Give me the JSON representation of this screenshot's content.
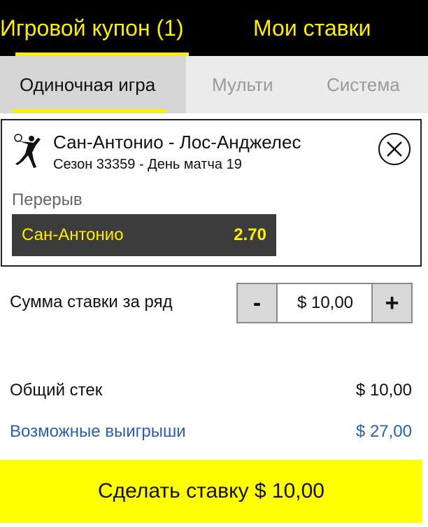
{
  "header": {
    "tabs": [
      {
        "label": "Игровой купон (1)"
      },
      {
        "label": "Мои ставки"
      }
    ]
  },
  "bet_type_tabs": [
    {
      "label": "Одиночная игра"
    },
    {
      "label": "Мульти"
    },
    {
      "label": "Система"
    }
  ],
  "bet_card": {
    "sport_icon": "basketball-player-icon",
    "match": "Сан-Антонио - Лос-Анджелес",
    "details": "Сезон 33359 - День матча 19",
    "market": "Перерыв",
    "selection": "Сан-Антонио",
    "odds": "2.70",
    "close_icon": "close-icon"
  },
  "stake": {
    "label": "Сумма ставки за ряд",
    "minus": "-",
    "value": "$ 10,00",
    "plus": "+"
  },
  "summary": {
    "total_label": "Общий стек",
    "total_value": "$ 10,00",
    "winnings_label": "Возможные выигрыши",
    "winnings_value": "$ 27,00"
  },
  "place_bet_label": "Сделать ставку $ 10,00",
  "colors": {
    "accent": "#ffee00",
    "header_bg": "#000000",
    "selection_bg": "#3c3c3c",
    "winnings": "#2a5fb0",
    "place_bet_bg": "#ffff00"
  }
}
